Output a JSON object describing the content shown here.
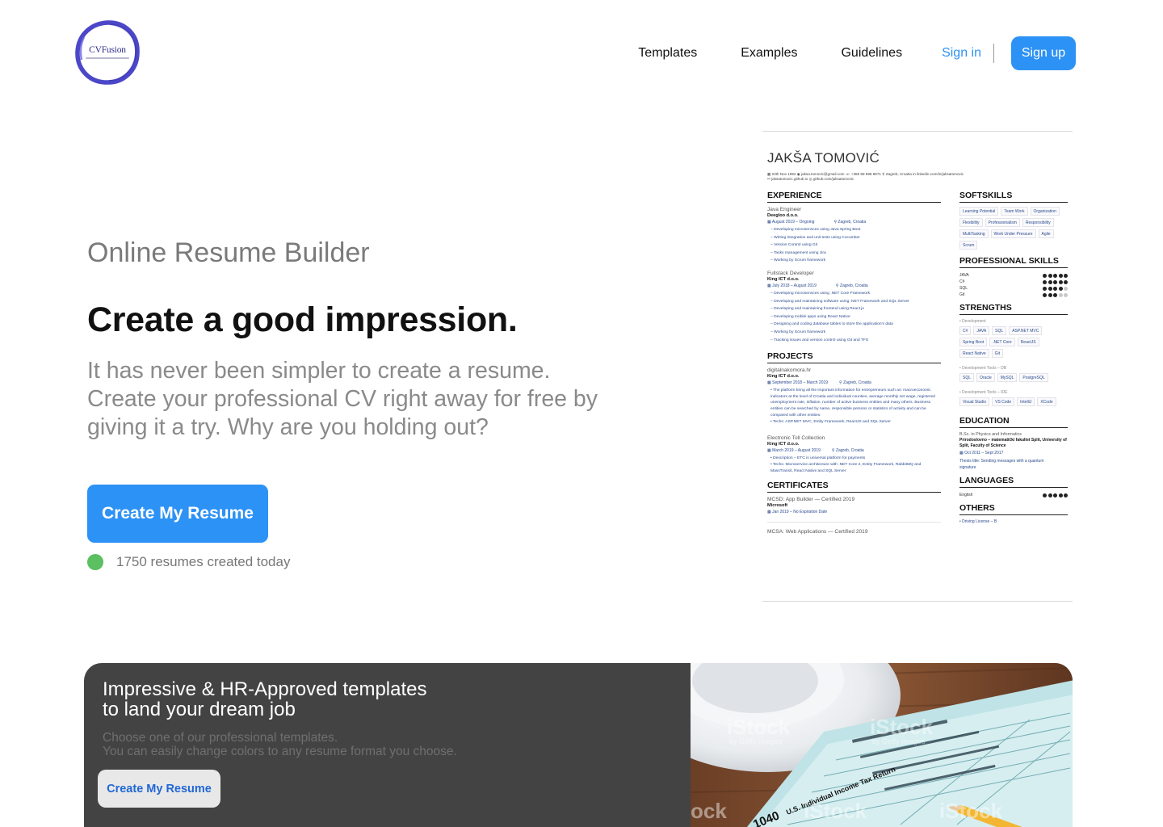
{
  "brand": {
    "name": "CVFusion",
    "ring_color": "#4c47c8"
  },
  "nav": {
    "links": [
      "Templates",
      "Examples",
      "Guidelines"
    ],
    "sign_in": "Sign in",
    "sign_up": "Sign up",
    "accent": "#2d92f5"
  },
  "hero": {
    "kicker": "Online Resume Builder",
    "title": "Create a good impression.",
    "description_lines": [
      "It has never been simpler to create a resume.",
      "Create your professional CV right away for free by",
      "giving it a try. Why are you holding out?"
    ],
    "cta": "Create My Resume",
    "counter_text": "1750 resumes created today",
    "status_color": "#5cbf61"
  },
  "resume": {
    "name": "JAKŠA TOMOVIĆ",
    "contact_line1": "▦ 23th Nov 1992   ◉ jaksa.tomovic@gmail.com   ☏ +385 98 998 8971   ⚲ Zagreb, Croatia   in linkedin.com/in/jaksatomovic",
    "contact_line2": "⚯ jaksatomovic.github.io   ◎ github.com/jaksatomovic",
    "experience": {
      "heading": "EXPERIENCE",
      "jobs": [
        {
          "role": "Java Engineer",
          "org": "Deegloo d.o.o.",
          "dates": "▦ August 2019 – Ongoing",
          "location": "⚲ Zagreb, Croatia",
          "bullets": [
            "– Developing microservices using Java Spring Boot",
            "– Writing integration and unit tests using Cucumber",
            "– Version Control using Git",
            "– Tasks management using Jira",
            "– Working by Scrum framework"
          ]
        },
        {
          "role": "Fullstack Developer",
          "org": "King ICT d.o.o.",
          "dates": "▦ July 2018 – August 2019",
          "location": "⚲ Zagreb, Croatia",
          "bullets": [
            "– Developing microservices using .NET Core Framework",
            "– Developing and maintaining software using .NET Framework and SQL Server",
            "– Developing and maintaining frontend using React.js",
            "– Developing mobile apps using React Native",
            "– Designing and coding database tables to store the application's data",
            "– Working by Scrum framework",
            "– Tracking issues and version control using Git and TFS"
          ]
        }
      ]
    },
    "projects": {
      "heading": "PROJECTS",
      "items": [
        {
          "role": "digitalnakomora.hr",
          "org": "King ICT d.o.o.",
          "dates": "▦ September 2018 – March 2019",
          "location": "⚲ Zagreb, Croatia",
          "bullets": [
            "• The platform bring all the important information for entrepreneurs such as: macroeconomic indicators at the level of Croatia and individual counties, average monthly net wage, registered unemployment rate, inflation, number of active business entities and many others. Business entities can be searched by name, responsible persons or statistics of activity and can be compared with other entities.",
            "• Techs: ASP.NET MVC, Entity Framework, ReactJS and SQL Server"
          ]
        },
        {
          "role": "Electronic Toll Collection",
          "org": "King ICT d.o.o.",
          "dates": "▦ March 2019 – August 2019",
          "location": "⚲ Zagreb, Croatia",
          "bullets": [
            "• Description – ETC is universal platform for payments",
            "• Techs: Microservice architecture with .NET Core 2, Entity Framework, RabbitMQ and MassTransit, React Native and SQL Server"
          ]
        }
      ]
    },
    "certificates": {
      "heading": "CERTIFICATES",
      "items": [
        {
          "title": "MCSD: App Builder — Certified 2019",
          "org": "Microsoft",
          "dates": "▦ Jan 2019 – No Expiration Date"
        },
        {
          "title": "MCSA: Web Applications — Certified 2019"
        }
      ]
    },
    "softskills": {
      "heading": "SOFTSKILLS",
      "tags": [
        "Learning Potential",
        "Team Work",
        "Organization",
        "Flexibility",
        "Professionalism",
        "Responsibility",
        "MultiTasking",
        "Work Under Pressure",
        "Agile",
        "Scrum"
      ]
    },
    "professional_skills": {
      "heading": "PROFESSIONAL SKILLS",
      "skills": [
        {
          "name": "JAVA",
          "level": 5
        },
        {
          "name": "C#",
          "level": 5
        },
        {
          "name": "SQL",
          "level": 4
        },
        {
          "name": "Git",
          "level": 3
        }
      ]
    },
    "strengths": {
      "heading": "STRENGTHS",
      "groups": [
        {
          "title": "• Development",
          "tags": [
            "C#",
            "JAVA",
            "SQL",
            "ASP.NET MVC",
            "Spring Boot",
            ".NET Core",
            "ReactJS",
            "React Native",
            "Git"
          ]
        },
        {
          "title": "• Development Tools – DB",
          "tags": [
            "SQL",
            "Oracle",
            "MySQL",
            "PostgreSQL"
          ]
        },
        {
          "title": "• Development Tools – IDE",
          "tags": [
            "Visual Studio",
            "VS Code",
            "IntelliJ",
            "XCode"
          ]
        }
      ]
    },
    "education": {
      "heading": "EDUCATION",
      "degree": "B.Sc. in Physics and Informatics",
      "school": "Prirodoslovno – matematički fakultet Split, University of Split, Faculty of Science",
      "dates": "▦ Oct 2011 – Sept 2017",
      "thesis": "Thesis title: Sending messages with a quantum signature"
    },
    "languages": {
      "heading": "LANGUAGES",
      "items": [
        {
          "name": "English",
          "level": 5
        }
      ]
    },
    "others": {
      "heading": "OTHERS",
      "items": [
        "• Driving License – B"
      ]
    }
  },
  "banner": {
    "title_lines": [
      "Impressive & HR-Approved templates",
      "to land your dream job"
    ],
    "subtitle_lines": [
      "Choose one of our professional templates.",
      "You can easily change colors to any resume format you choose."
    ],
    "cta": "Create My Resume",
    "photo": {
      "watermark": "iStock",
      "watermark_credit": "by Getty Images",
      "form_number": "1040",
      "form_title": "U.S. Individual Income Tax Return"
    }
  }
}
